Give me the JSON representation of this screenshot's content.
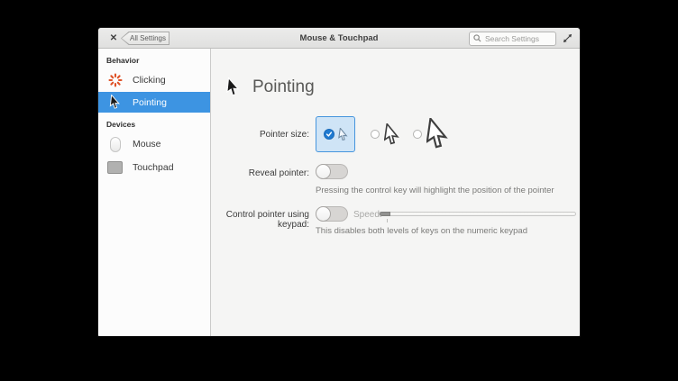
{
  "titlebar": {
    "close_icon": "✕",
    "back_button_label": "All Settings",
    "title": "Mouse & Touchpad",
    "search_placeholder": "Search Settings",
    "search_icon": "magnifier",
    "expand_icon": "resize-diagonal-arrows"
  },
  "sidebar": {
    "sections": [
      {
        "header": "Behavior",
        "items": [
          {
            "label": "Clicking",
            "icon": "starburst-icon",
            "selected": false
          },
          {
            "label": "Pointing",
            "icon": "cursor-icon",
            "selected": true
          }
        ]
      },
      {
        "header": "Devices",
        "items": [
          {
            "label": "Mouse",
            "icon": "mouse-icon",
            "selected": false
          },
          {
            "label": "Touchpad",
            "icon": "touchpad-icon",
            "selected": false
          }
        ]
      }
    ]
  },
  "main": {
    "heading": "Pointing",
    "heading_icon": "cursor-icon",
    "pointer_size": {
      "label": "Pointer size:",
      "options": [
        {
          "name": "small",
          "selected": true
        },
        {
          "name": "medium",
          "selected": false
        },
        {
          "name": "large",
          "selected": false
        }
      ]
    },
    "reveal_pointer": {
      "label": "Reveal pointer:",
      "state": "off",
      "description": "Pressing the control key will highlight the position of the pointer"
    },
    "keypad": {
      "label": "Control pointer using keypad:",
      "state": "off",
      "speed_label": "Speed:",
      "speed_value_percent": 0,
      "description": "This disables both levels of keys on the numeric keypad"
    }
  },
  "colors": {
    "selection_blue": "#3d94e2",
    "selected_option_bg": "#cfe4f6",
    "selected_option_border": "#4695dd",
    "radio_checked": "#1f7ad1",
    "accent_orange": "#df5227",
    "titlebar_bg": "#e6e6e5",
    "sidebar_bg": "#fcfcfc",
    "content_bg": "#f5f5f4"
  }
}
